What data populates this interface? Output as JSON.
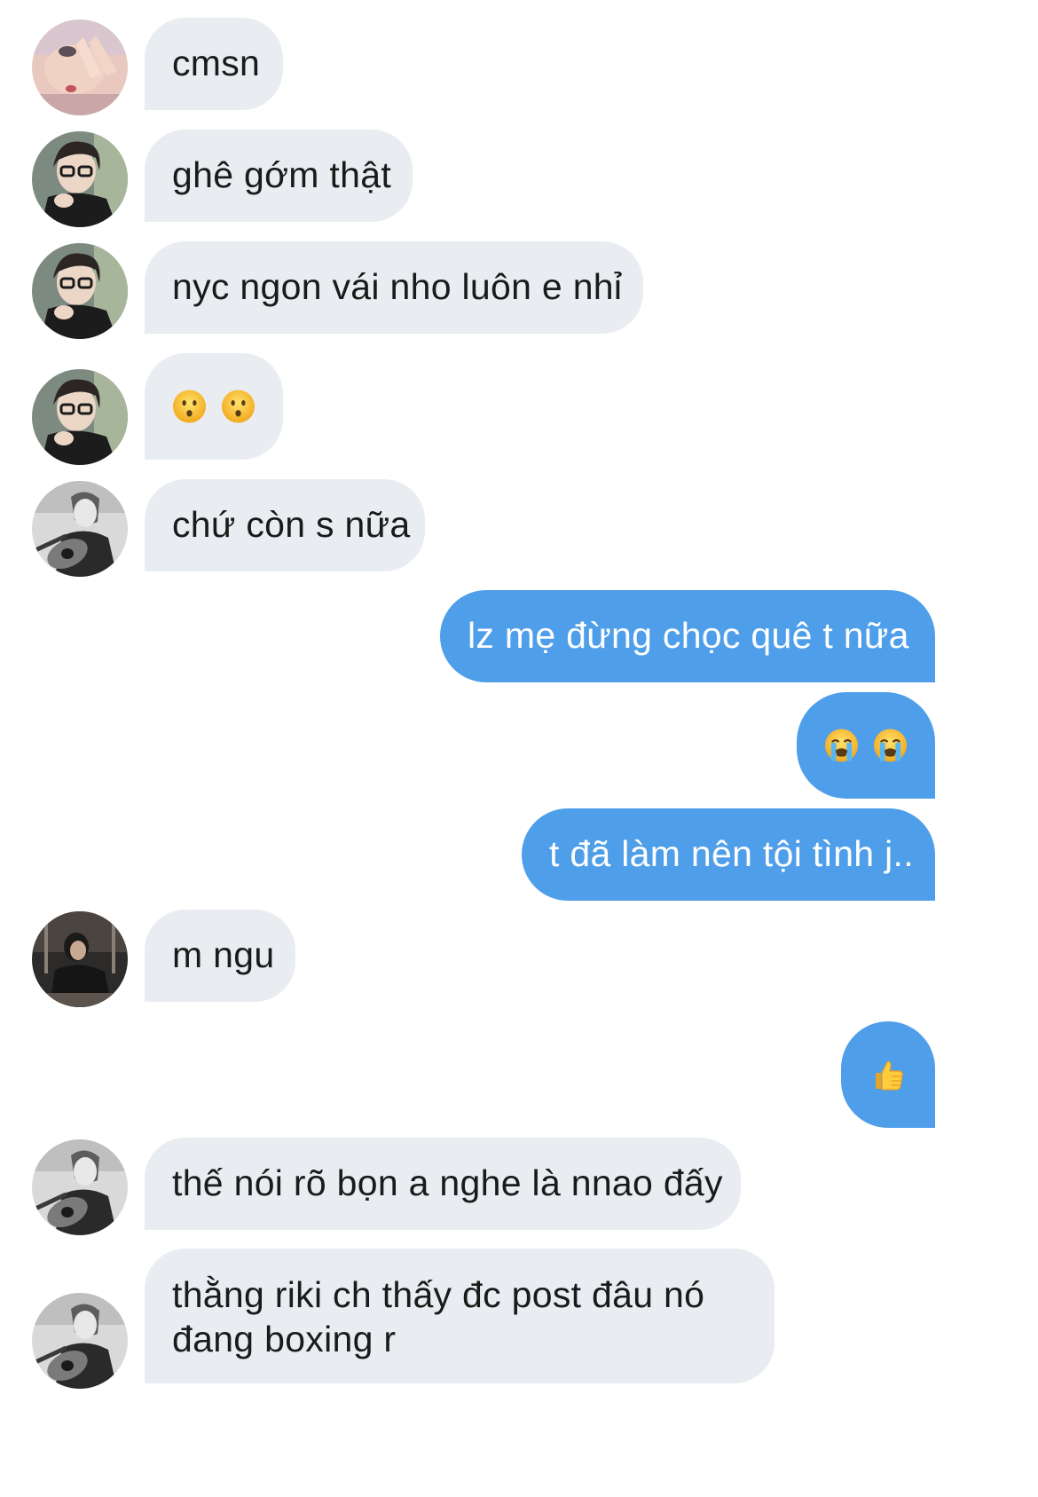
{
  "conversation": {
    "messages": [
      {
        "direction": "incoming",
        "avatar_icon": "avatar-hand-photo-icon",
        "text": "cmsn"
      },
      {
        "direction": "incoming",
        "avatar_icon": "avatar-glasses-guy-icon",
        "text": "ghê gớm thật"
      },
      {
        "direction": "incoming",
        "avatar_icon": "avatar-glasses-guy-icon",
        "text": "nyc ngon vái nho luôn e nhỉ"
      },
      {
        "direction": "incoming",
        "avatar_icon": "avatar-glasses-guy-icon",
        "emojis": [
          "hushed-face-icon",
          "hushed-face-icon"
        ]
      },
      {
        "direction": "incoming",
        "avatar_icon": "avatar-guitar-guy-icon",
        "text": "chứ còn s nữa"
      },
      {
        "direction": "outgoing",
        "text": "lz mẹ đừng chọc quê t nữa"
      },
      {
        "direction": "outgoing",
        "emojis": [
          "loudly-crying-face-icon",
          "loudly-crying-face-icon"
        ]
      },
      {
        "direction": "outgoing",
        "text": "t đã làm nên tội tình j.."
      },
      {
        "direction": "incoming",
        "avatar_icon": "avatar-dark-jacket-guy-icon",
        "text": "m ngu"
      },
      {
        "direction": "outgoing",
        "emojis": [
          "thumbs-up-icon"
        ]
      },
      {
        "direction": "incoming",
        "avatar_icon": "avatar-guitar-guy-icon",
        "text": "thế nói rõ bọn a nghe là nnao đấy"
      },
      {
        "direction": "incoming",
        "avatar_icon": "avatar-guitar-guy-icon",
        "text": "thằng riki ch thấy đc post đâu nó đang boxing r"
      }
    ]
  },
  "colors": {
    "incoming_bubble": "#e9edf1",
    "outgoing_bubble": "#4f9eea",
    "incoming_text": "#1a1a1a",
    "outgoing_text": "#ffffff"
  }
}
